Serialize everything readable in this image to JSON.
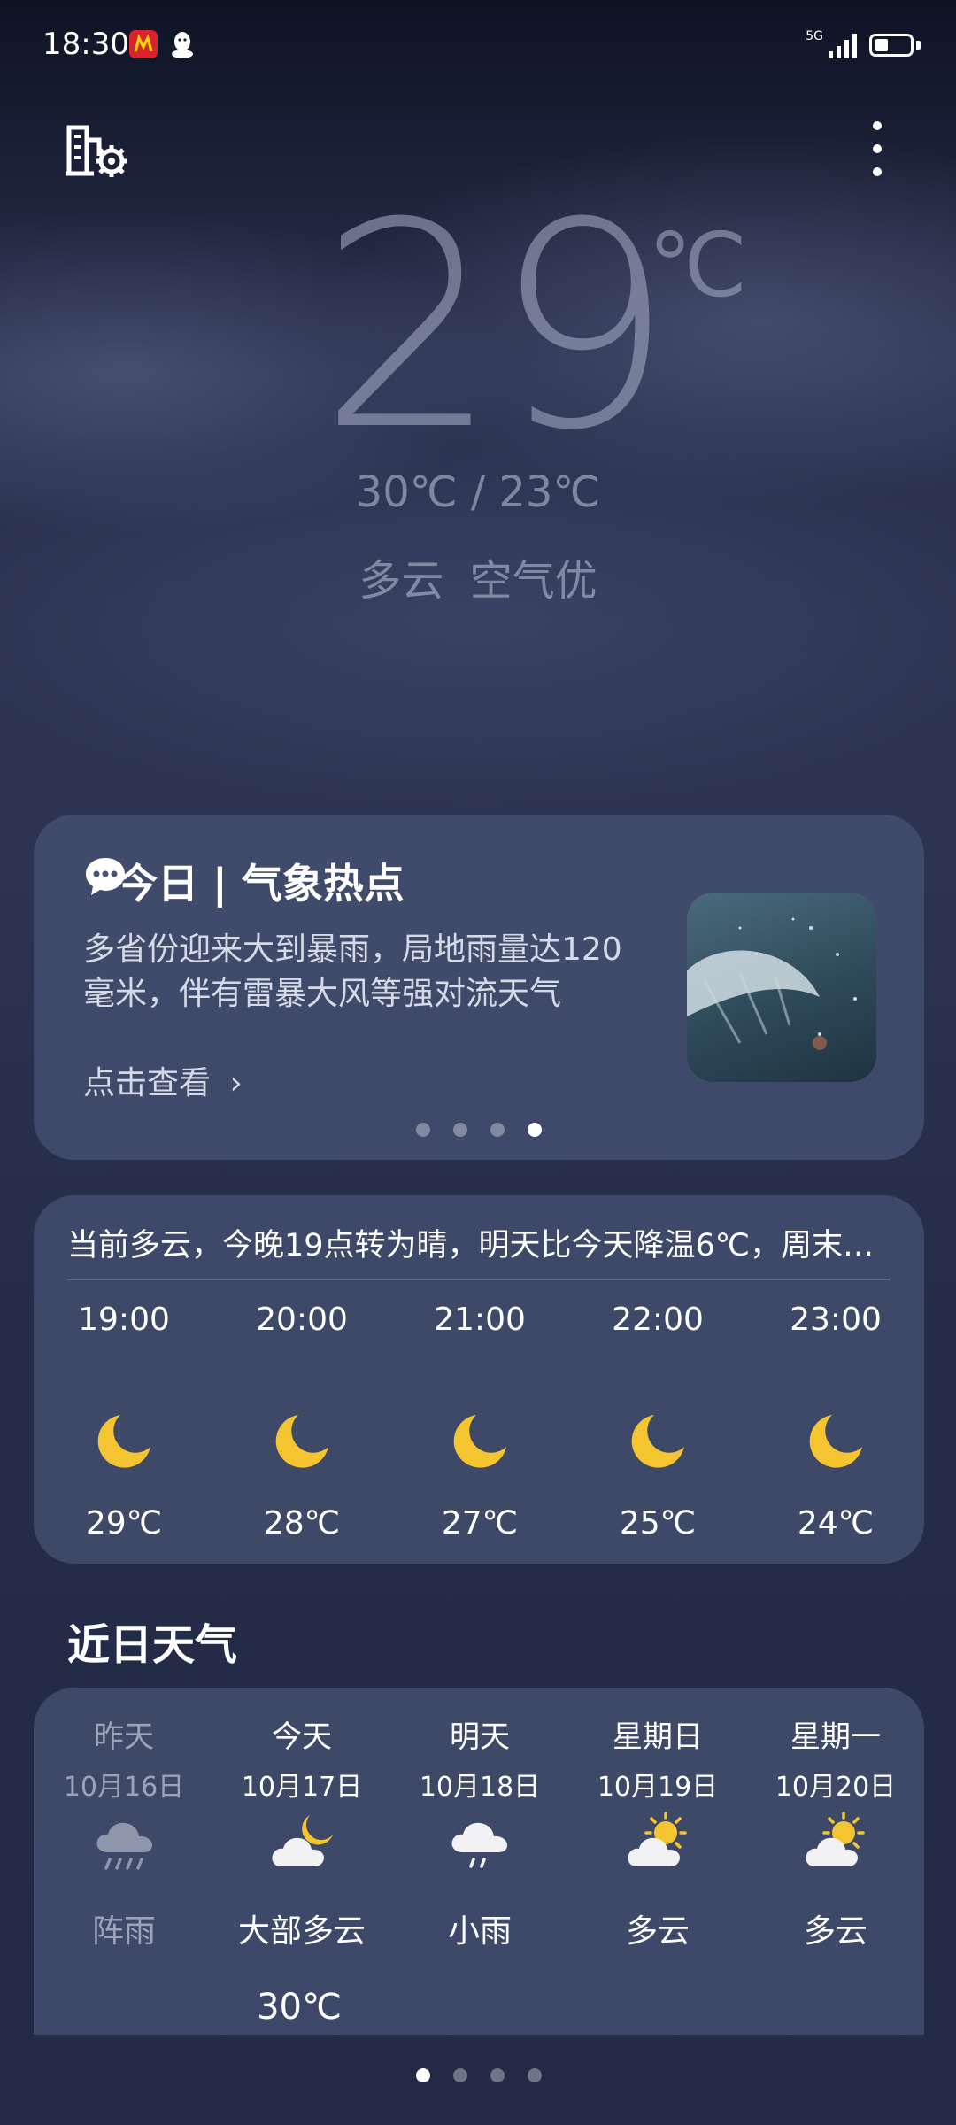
{
  "status_bar": {
    "time": "18:30",
    "network_top": "5G",
    "network_bottom": "1l",
    "app_icons": [
      "mcdonalds-app-icon",
      "qq-icon"
    ]
  },
  "toolbar": {
    "city_settings_icon": "city-settings-icon",
    "menu_icon": "more-vertical-icon"
  },
  "current": {
    "temp": "29",
    "unit": "℃",
    "range": "30℃ / 23℃",
    "condition": "多云  空气优"
  },
  "hot_card": {
    "title": "今日 | 气象热点",
    "text": "多省份迎来大到暴雨，局地雨量达120毫米，伴有雷暴大风等强对流天气",
    "link": "点击查看",
    "dot_count": 4,
    "active_dot": 3
  },
  "hourly": {
    "summary": "当前多云，今晚19点转为晴，明天比今天降温6℃，周末…",
    "items": [
      {
        "time": "19:00",
        "icon": "moon-icon",
        "temp": "29℃"
      },
      {
        "time": "20:00",
        "icon": "moon-icon",
        "temp": "28℃"
      },
      {
        "time": "21:00",
        "icon": "moon-icon",
        "temp": "27℃"
      },
      {
        "time": "22:00",
        "icon": "moon-icon",
        "temp": "25℃"
      },
      {
        "time": "23:00",
        "icon": "moon-icon",
        "temp": "24℃"
      }
    ]
  },
  "daily": {
    "title": "近日天气",
    "items": [
      {
        "name": "昨天",
        "date": "10月16日",
        "icon": "shower-icon",
        "cond": "阵雨",
        "past": true
      },
      {
        "name": "今天",
        "date": "10月17日",
        "icon": "moon-cloud-icon",
        "cond": "大部多云",
        "past": false
      },
      {
        "name": "明天",
        "date": "10月18日",
        "icon": "light-rain-icon",
        "cond": "小雨",
        "past": false
      },
      {
        "name": "星期日",
        "date": "10月19日",
        "icon": "sun-cloud-icon",
        "cond": "多云",
        "past": false
      },
      {
        "name": "星期一",
        "date": "10月20日",
        "icon": "sun-cloud-icon",
        "cond": "多云",
        "past": false
      }
    ],
    "today_high": "30℃"
  },
  "pager": {
    "dot_count": 4,
    "active": 0
  },
  "colors": {
    "accent_yellow": "#f5c531",
    "card_bg": "#485476",
    "text_muted": "#aab0c8"
  }
}
